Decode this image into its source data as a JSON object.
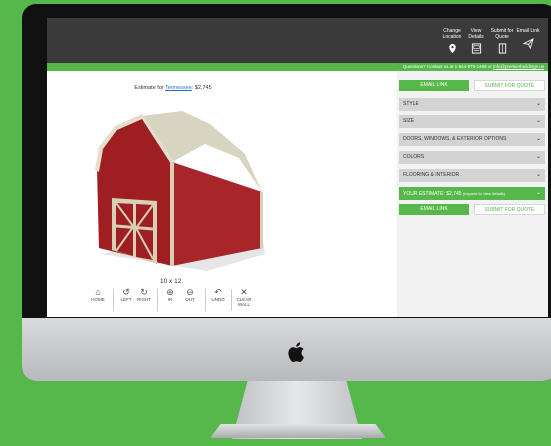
{
  "topbar": {
    "buttons": [
      {
        "label": "Change Location",
        "icon": "location-pin-icon"
      },
      {
        "label": "View Details",
        "icon": "details-icon"
      },
      {
        "label": "Submit for Quote",
        "icon": "door-icon"
      },
      {
        "label": "Email Link",
        "icon": "send-icon"
      }
    ]
  },
  "contact": {
    "text": "Questions? Contact us at 1-844-879-1468 or",
    "email": "info@premierbuildings.us"
  },
  "estimate": {
    "prefix": "Estimate for",
    "state": "Tennessee",
    "price": ": $2,745"
  },
  "building": {
    "size": "10 x 12",
    "colors": {
      "walls": "#9e1e22",
      "trim": "#d9cfb4",
      "roof": "#d8d4c2"
    }
  },
  "controls": [
    {
      "label": "HOME",
      "icon": "home-icon"
    },
    {
      "label": "LEFT",
      "icon": "rotate-left-icon"
    },
    {
      "label": "RIGHT",
      "icon": "rotate-right-icon"
    },
    {
      "label": "IN",
      "icon": "zoom-in-icon"
    },
    {
      "label": "OUT",
      "icon": "zoom-out-icon"
    },
    {
      "label": "UNDO",
      "icon": "undo-icon"
    },
    {
      "label": "CLEAR WALL",
      "icon": "close-icon"
    }
  ],
  "panel": {
    "email_link": "EMAIL LINK",
    "submit_quote": "SUBMIT FOR QUOTE",
    "sections": [
      "STYLE",
      "SIZE",
      "DOORS, WINDOWS, & EXTERIOR OPTIONS",
      "COLORS",
      "FLOORING & INTERIOR"
    ],
    "your_estimate": "YOUR ESTIMATE: $2,745",
    "expand_hint": "(expand to view details)"
  },
  "colors": {
    "accent": "#56b84a",
    "topbar": "#3a3a3a"
  }
}
